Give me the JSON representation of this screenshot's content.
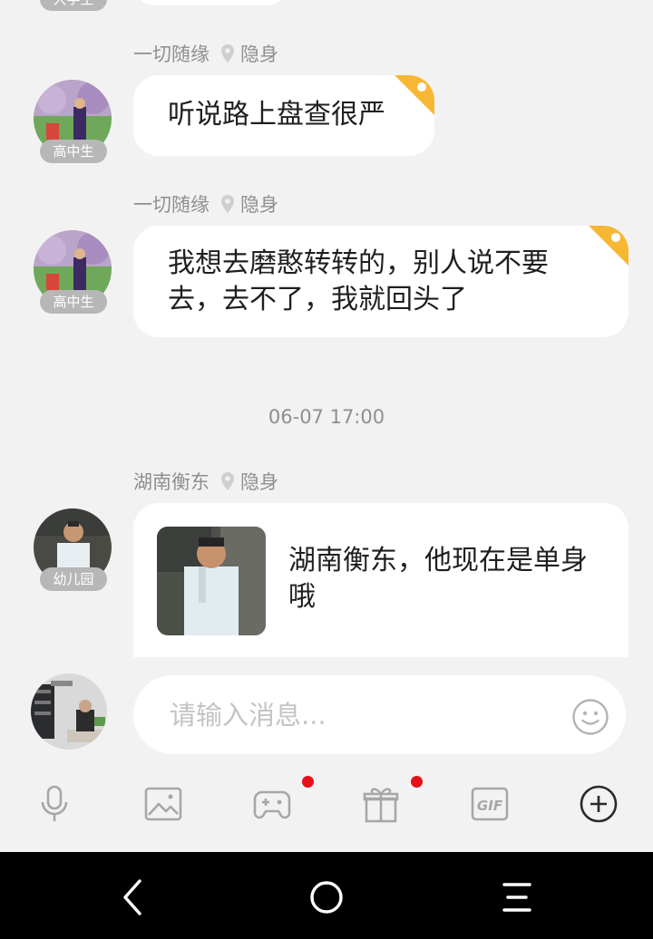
{
  "messages": [
    {
      "sender": "一切随缘",
      "location": "隐身",
      "grade": "高中生",
      "text": "听说路上盘查很严"
    },
    {
      "sender": "一切随缘",
      "location": "隐身",
      "grade": "高中生",
      "text": "我想去磨憨转转的，别人说不要去，去不了，我就回头了"
    }
  ],
  "top_partial_badge": "大学生",
  "timestamp": "06-07 17:00",
  "card_message": {
    "sender": "湖南衡东",
    "location": "隐身",
    "grade": "幼儿园",
    "text": "湖南衡东，他现在是单身哦"
  },
  "input": {
    "placeholder": "请输入消息..."
  },
  "toolbar": {
    "items": [
      "microphone-icon",
      "image-icon",
      "game-controller-icon",
      "gift-icon",
      "gif-icon",
      "plus-circle-icon"
    ],
    "badge_color": "#e8101a"
  },
  "nav": {
    "items": [
      "back-icon",
      "home-icon",
      "menu-icon"
    ]
  },
  "colors": {
    "background": "#f2f2f2",
    "bubble": "#ffffff",
    "corner_tag": "#f7b733",
    "badge": "#b7b7b7"
  }
}
